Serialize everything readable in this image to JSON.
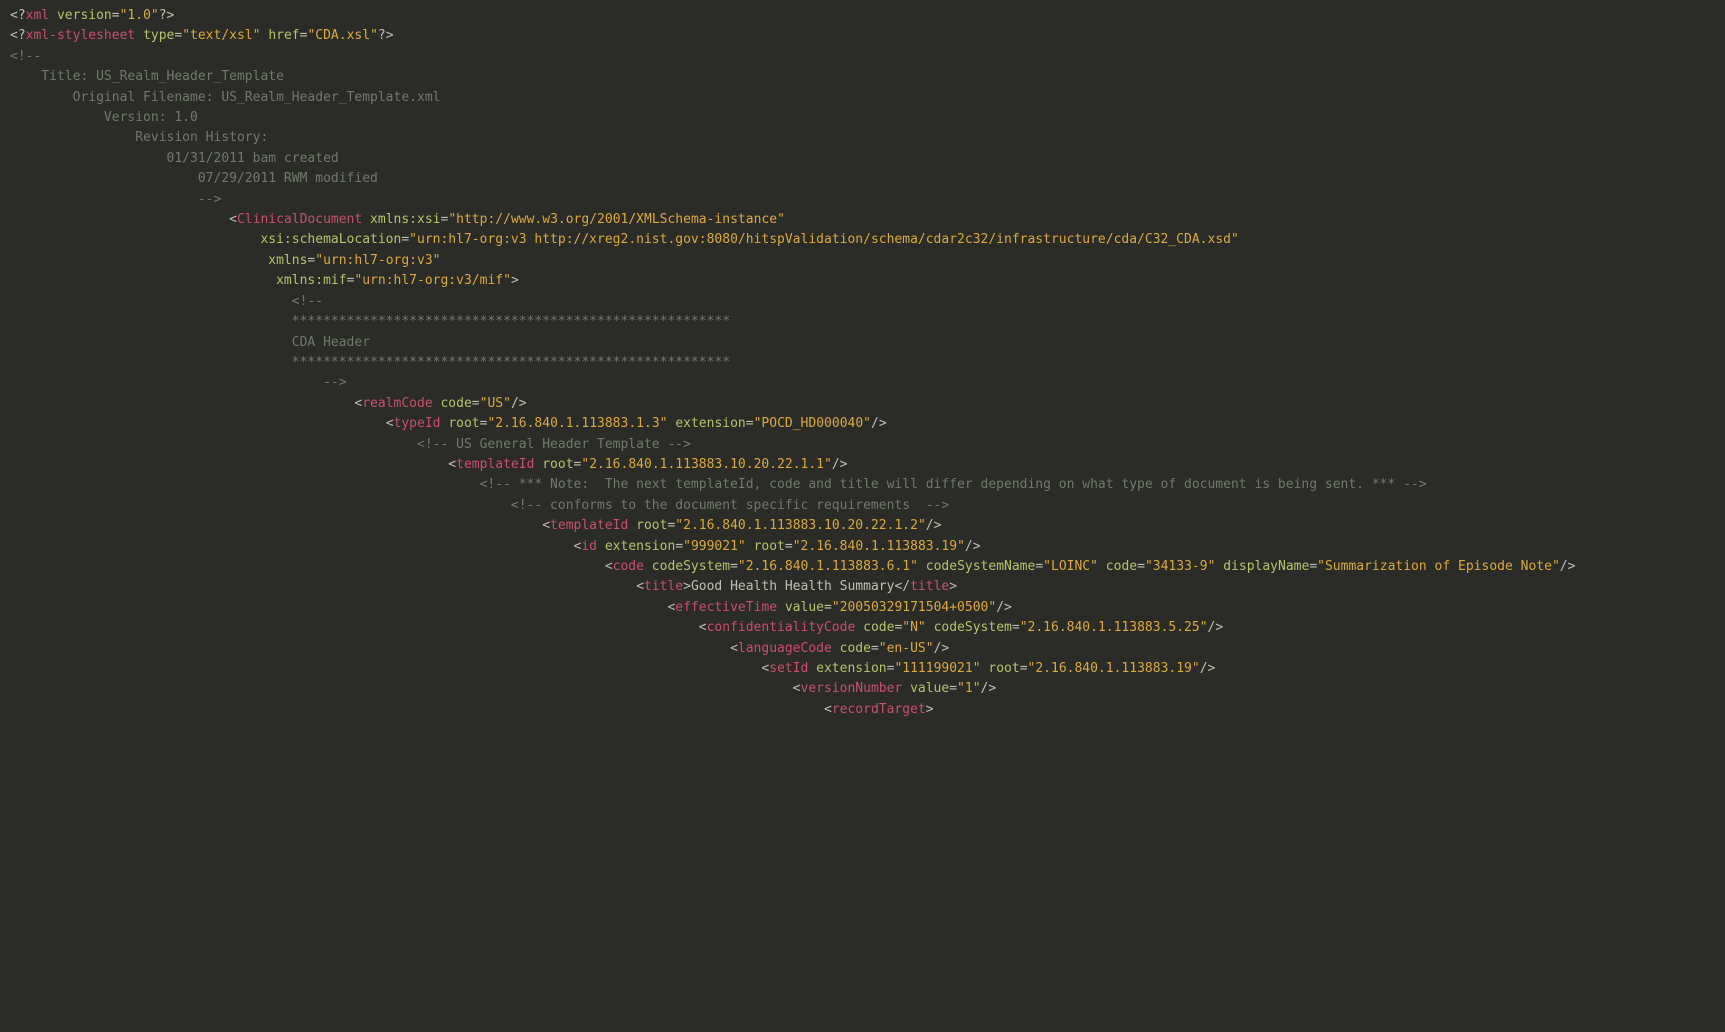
{
  "pi1": {
    "prefix": "<?",
    "target": "xml",
    "attrs": [
      [
        "version",
        "1.0"
      ]
    ],
    "suffix": "?>"
  },
  "pi2": {
    "prefix": "<?",
    "target": "xml-stylesheet",
    "attrs": [
      [
        "type",
        "text/xsl"
      ],
      [
        "href",
        "CDA.xsl"
      ]
    ],
    "suffix": "?>"
  },
  "comment_open": "<!--",
  "comment_lines": {
    "title": "    Title: US_Realm_Header_Template",
    "filename": "        Original Filename: US_Realm_Header_Template.xml",
    "version": "            Version: 1.0",
    "revision": "                Revision History:",
    "rev1": "                    01/31/2011 bam created",
    "rev2": "                        07/29/2011 RWM modified",
    "blank": "",
    "close": "                        -->",
    "stars1": "                                    ********************************************************",
    "header": "                                    CDA Header",
    "stars2": "                                    ********************************************************",
    "close2": "                                        -->",
    "us_header": "                                                    <!-- US General Header Template -->",
    "note": "                                                            <!-- *** Note:  The next templateId, code and title will differ depending on what type of document is being sent. *** -->",
    "conforms": "                                                                <!-- conforms to the document specific requirements  -->"
  },
  "indent": {
    "clDoc": "                            ",
    "attrL2": "                                ",
    "attrL3": "                                 ",
    "attrL4": "                                  ",
    "innerCommentOpen": "                                    <!--",
    "realm": "                                            ",
    "typeId": "                                                ",
    "tmpl1": "                                                        ",
    "tmpl2": "                                                                    ",
    "id": "                                                                        ",
    "code": "                                                                            ",
    "title": "                                                                                ",
    "eff": "                                                                                    ",
    "conf": "                                                                                        ",
    "lang": "                                                                                            ",
    "setId": "                                                                                                ",
    "ver": "                                                                                                    ",
    "rec": "                                                                                                        "
  },
  "clinicalDocument": {
    "name": "ClinicalDocument",
    "ns_xsi": [
      "xmlns:xsi",
      "http://www.w3.org/2001/XMLSchema-instance"
    ],
    "schemaLoc": [
      "xsi:schemaLocation",
      "urn:hl7-org:v3 http://xreg2.nist.gov:8080/hitspValidation/schema/cdar2c32/infrastructure/cda/C32_CDA.xsd"
    ],
    "xmlns": [
      "xmlns",
      "urn:hl7-org:v3"
    ],
    "xmlns_mif": [
      "xmlns:mif",
      "urn:hl7-org:v3/mif"
    ]
  },
  "realmCode": {
    "name": "realmCode",
    "attrs": [
      [
        "code",
        "US"
      ]
    ]
  },
  "typeId": {
    "name": "typeId",
    "attrs": [
      [
        "root",
        "2.16.840.1.113883.1.3"
      ],
      [
        "extension",
        "POCD_HD000040"
      ]
    ]
  },
  "templateId1": {
    "name": "templateId",
    "attrs": [
      [
        "root",
        "2.16.840.1.113883.10.20.22.1.1"
      ]
    ]
  },
  "templateId2": {
    "name": "templateId",
    "attrs": [
      [
        "root",
        "2.16.840.1.113883.10.20.22.1.2"
      ]
    ]
  },
  "id": {
    "name": "id",
    "attrs": [
      [
        "extension",
        "999021"
      ],
      [
        "root",
        "2.16.840.1.113883.19"
      ]
    ]
  },
  "code": {
    "name": "code",
    "attrs": [
      [
        "codeSystem",
        "2.16.840.1.113883.6.1"
      ],
      [
        "codeSystemName",
        "LOINC"
      ],
      [
        "code",
        "34133-9"
      ],
      [
        "displayName",
        "Summarization of Episode Note"
      ]
    ]
  },
  "titleEl": {
    "name": "title",
    "text": "Good Health Health Summary"
  },
  "effectiveTime": {
    "name": "effectiveTime",
    "attrs": [
      [
        "value",
        "20050329171504+0500"
      ]
    ]
  },
  "confidentialityCode": {
    "name": "confidentialityCode",
    "attrs": [
      [
        "code",
        "N"
      ],
      [
        "codeSystem",
        "2.16.840.1.113883.5.25"
      ]
    ]
  },
  "languageCode": {
    "name": "languageCode",
    "attrs": [
      [
        "code",
        "en-US"
      ]
    ]
  },
  "setId": {
    "name": "setId",
    "attrs": [
      [
        "extension",
        "111199021"
      ],
      [
        "root",
        "2.16.840.1.113883.19"
      ]
    ]
  },
  "versionNumber": {
    "name": "versionNumber",
    "attrs": [
      [
        "value",
        "1"
      ]
    ]
  },
  "recordTarget": {
    "name": "recordTarget"
  }
}
